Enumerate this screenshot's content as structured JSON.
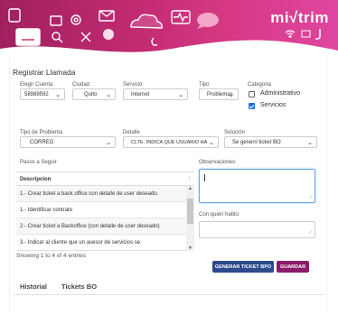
{
  "banner": {
    "brand": "mi√trim",
    "icons": [
      "email-icon",
      "cloud-icon",
      "pulse-icon",
      "chat-bubble-icon",
      "phone-icon",
      "gear-icon",
      "tools-icon",
      "wifi-icon",
      "signal-icon"
    ]
  },
  "form": {
    "title": "Registrar Llamada",
    "account_label": "Elegir Cuenta",
    "account_value": "58989592",
    "city_label": "Ciudad",
    "city_value": "Quito",
    "service_label": "Servicio",
    "service_value": "Internet",
    "type_label": "Tipo",
    "type_value": "Problemas",
    "category_label": "Categoria",
    "category_options": [
      {
        "label": "Administrativo",
        "checked": false
      },
      {
        "label": "Servicios",
        "checked": true
      }
    ],
    "problem_type_label": "Tipo de Problema",
    "problem_type_value": "CORREO",
    "detail_label": "Detalle",
    "detail_value": "CLTE. INDICA QUE USUARIO HA S",
    "solution_label": "Solución",
    "solution_value": "Se generó ticket BO",
    "steps_label": "Pasos a Seguir",
    "observations_label": "Observaciones:",
    "contact_label": "Con quien hablo:"
  },
  "steps_table": {
    "header": "Descripcion",
    "sort_glyph": "↕",
    "rows": [
      "1.- Crear ticket a back office con detalle de user deseado.",
      "1.- Identificar contrato",
      "2.- Crear ticket a Backoffice (con detalle de user deseado)",
      "3.- Indicar al cliente que un asesor de servicios se"
    ],
    "info": "Showing 1 to 4 of 4 entries"
  },
  "actions": {
    "generate": "GENERAR TICKET BPO",
    "save": "GUARDAR"
  },
  "tabs": [
    "Historial",
    "Tickets BO"
  ],
  "colors": {
    "banner": "#c22a72",
    "primary_button": "#2c4a8c",
    "secondary_button": "#8b1a6a",
    "checkbox": "#1a73e8"
  }
}
